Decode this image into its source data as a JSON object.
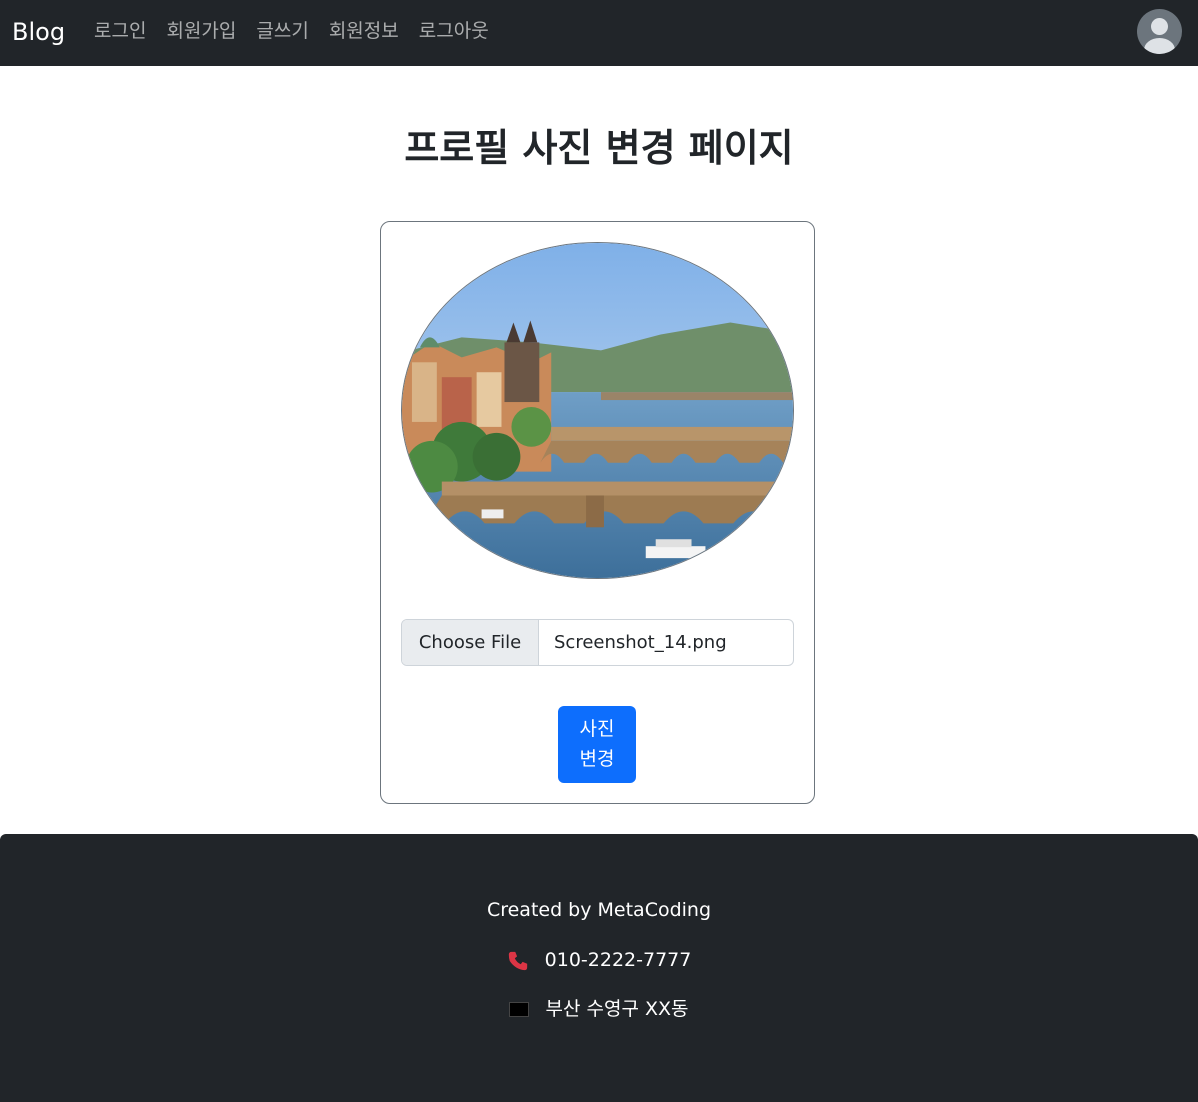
{
  "navbar": {
    "brand": "Blog",
    "links": [
      "로그인",
      "회원가입",
      "글쓰기",
      "회원정보",
      "로그아웃"
    ]
  },
  "page": {
    "title": "프로필 사진 변경 페이지"
  },
  "form": {
    "file_button": "Choose File",
    "file_name": "Screenshot_14.png",
    "submit_line1": "사진",
    "submit_line2": "변경"
  },
  "footer": {
    "created_by": "Created by MetaCoding",
    "phone": "010-2222-7777",
    "address": "부산 수영구 XX동"
  },
  "colors": {
    "navbar_bg": "#212529",
    "primary": "#0d6efd",
    "phone_icon": "#dc3545"
  }
}
